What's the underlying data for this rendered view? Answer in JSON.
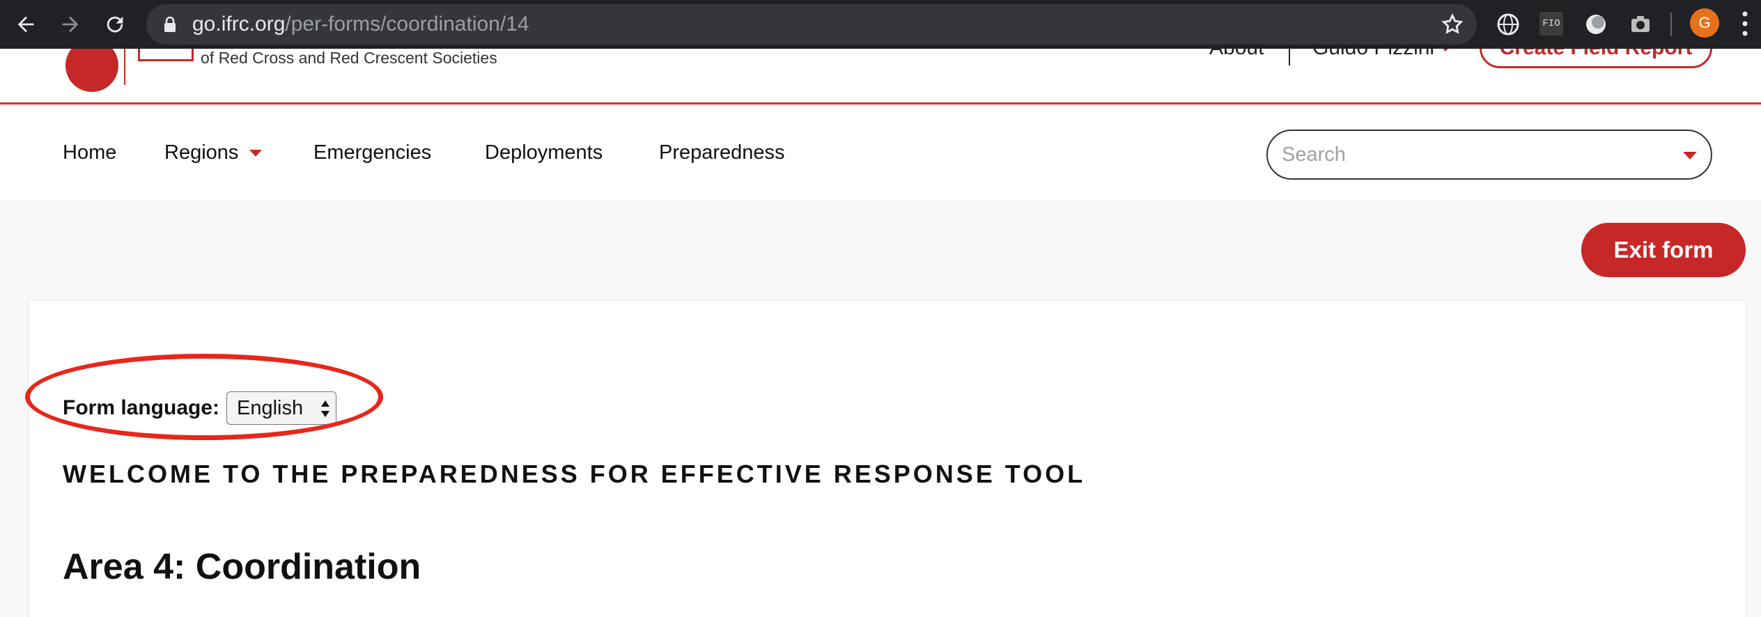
{
  "browser": {
    "url_host": "go.ifrc.org",
    "url_path": "/per-forms/coordination/14",
    "extension_fio": "FIO",
    "avatar_letter": "G"
  },
  "header": {
    "org_line": "of Red Cross and Red Crescent Societies",
    "about": "About",
    "user": "Guido Pizzini",
    "create_field_report": "Create Field Report",
    "brand_color": "#c62828"
  },
  "nav": {
    "items": [
      "Home",
      "Regions",
      "Emergencies",
      "Deployments",
      "Preparedness"
    ],
    "search_placeholder": "Search"
  },
  "form": {
    "exit_label": "Exit form",
    "language_label": "Form language:",
    "language_value": "English",
    "welcome": "WELCOME TO THE PREPAREDNESS FOR EFFECTIVE RESPONSE TOOL",
    "area_title": "Area 4: Coordination"
  },
  "annotation_color": "#e8261b"
}
